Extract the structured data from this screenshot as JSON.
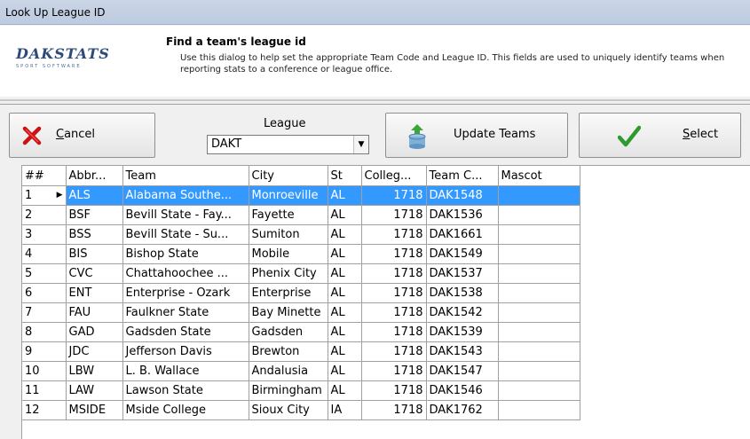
{
  "window": {
    "title": "Look Up League ID"
  },
  "header": {
    "logo_main": "DAKSTATS",
    "logo_sub": "SPORT SOFTWARE",
    "title": "Find a team's league id",
    "description": "Use this dialog to help set the appropriate Team Code and League ID.  This fields are used to uniquely identify teams when reporting stats to a conference or league office."
  },
  "toolbar": {
    "cancel_label": "ancel",
    "cancel_mnemonic": "C",
    "league_label": "League",
    "league_value": "DAKT",
    "update_label": "Update Teams",
    "select_label": "elect",
    "select_mnemonic": "S"
  },
  "grid": {
    "columns": [
      "##",
      "Abbr...",
      "Team",
      "City",
      "St",
      "Colleg...",
      "Team C...",
      "Mascot"
    ],
    "rows": [
      [
        "1",
        "ALS",
        "Alabama Southe...",
        "Monroeville",
        "AL",
        "1718",
        "DAK1548",
        ""
      ],
      [
        "2",
        "BSF",
        "Bevill State - Fay...",
        "Fayette",
        "AL",
        "1718",
        "DAK1536",
        ""
      ],
      [
        "3",
        "BSS",
        "Bevill State - Su...",
        "Sumiton",
        "AL",
        "1718",
        "DAK1661",
        ""
      ],
      [
        "4",
        "BIS",
        "Bishop State",
        "Mobile",
        "AL",
        "1718",
        "DAK1549",
        ""
      ],
      [
        "5",
        "CVC",
        "Chattahoochee ...",
        "Phenix City",
        "AL",
        "1718",
        "DAK1537",
        ""
      ],
      [
        "6",
        "ENT",
        "Enterprise - Ozark",
        "Enterprise",
        "AL",
        "1718",
        "DAK1538",
        ""
      ],
      [
        "7",
        "FAU",
        "Faulkner State",
        "Bay Minette",
        "AL",
        "1718",
        "DAK1542",
        ""
      ],
      [
        "8",
        "GAD",
        "Gadsden State",
        "Gadsden",
        "AL",
        "1718",
        "DAK1539",
        ""
      ],
      [
        "9",
        "JDC",
        "Jefferson Davis",
        "Brewton",
        "AL",
        "1718",
        "DAK1543",
        ""
      ],
      [
        "10",
        "LBW",
        "L. B. Wallace",
        "Andalusia",
        "AL",
        "1718",
        "DAK1547",
        ""
      ],
      [
        "11",
        "LAW",
        "Lawson State",
        "Birmingham",
        "AL",
        "1718",
        "DAK1546",
        ""
      ],
      [
        "12",
        "MSIDE",
        "Mside College",
        "Sioux City",
        "IA",
        "1718",
        "DAK1762",
        ""
      ]
    ],
    "selected_row": 0
  },
  "colors": {
    "selection": "#3399ff",
    "cancel_icon": "#cc1111",
    "select_icon": "#33a532"
  }
}
